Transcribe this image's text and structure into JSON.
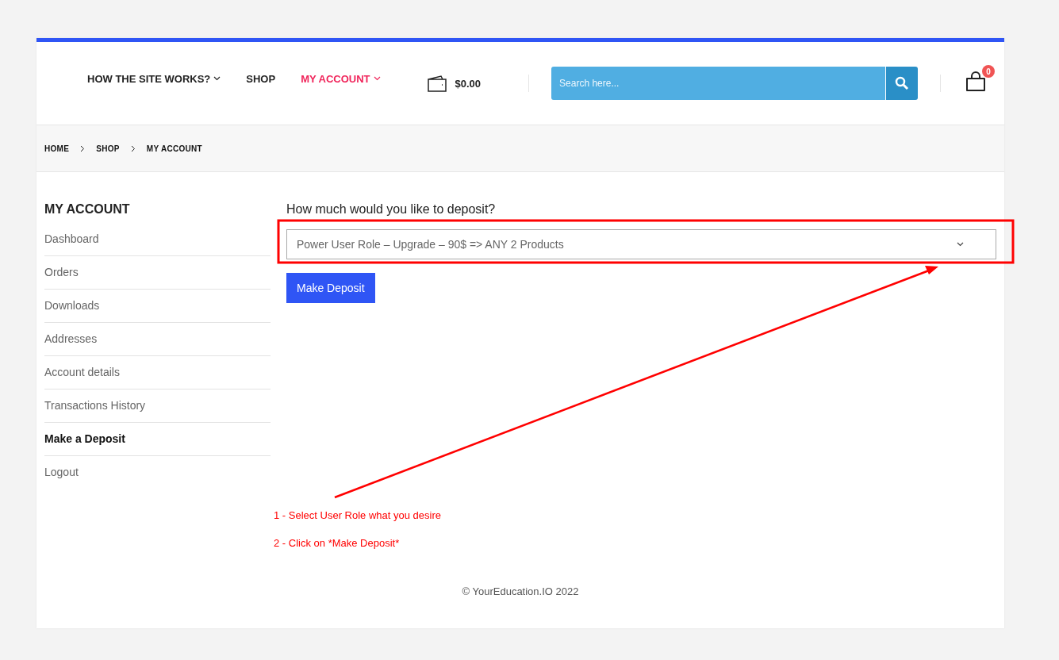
{
  "nav": [
    {
      "label": "HOW THE SITE WORKS?",
      "has_dropdown": true,
      "selected": false
    },
    {
      "label": "SHOP",
      "has_dropdown": false,
      "selected": false
    },
    {
      "label": "MY ACCOUNT",
      "has_dropdown": true,
      "selected": true
    }
  ],
  "wallet": {
    "amount": "$0.00"
  },
  "search": {
    "placeholder": "Search here..."
  },
  "cart": {
    "count": "0"
  },
  "breadcrumb": [
    "HOME",
    "SHOP",
    "MY ACCOUNT"
  ],
  "sidebar": {
    "title": "MY ACCOUNT",
    "items": [
      {
        "label": "Dashboard",
        "selected": false
      },
      {
        "label": "Orders",
        "selected": false
      },
      {
        "label": "Downloads",
        "selected": false
      },
      {
        "label": "Addresses",
        "selected": false
      },
      {
        "label": "Account details",
        "selected": false
      },
      {
        "label": "Transactions History",
        "selected": false
      },
      {
        "label": "Make a Deposit",
        "selected": true
      },
      {
        "label": "Logout",
        "selected": false
      }
    ]
  },
  "deposit": {
    "question": "How much would you like to deposit?",
    "value": "Power User Role – Upgrade – 90$ => ANY 2 Products",
    "button": "Make Deposit"
  },
  "annotations": {
    "notes": [
      "1 - Select User Role what you desire",
      "2 - Click on *Make Deposit*"
    ]
  },
  "footer": "© YourEducation.IO 2022"
}
